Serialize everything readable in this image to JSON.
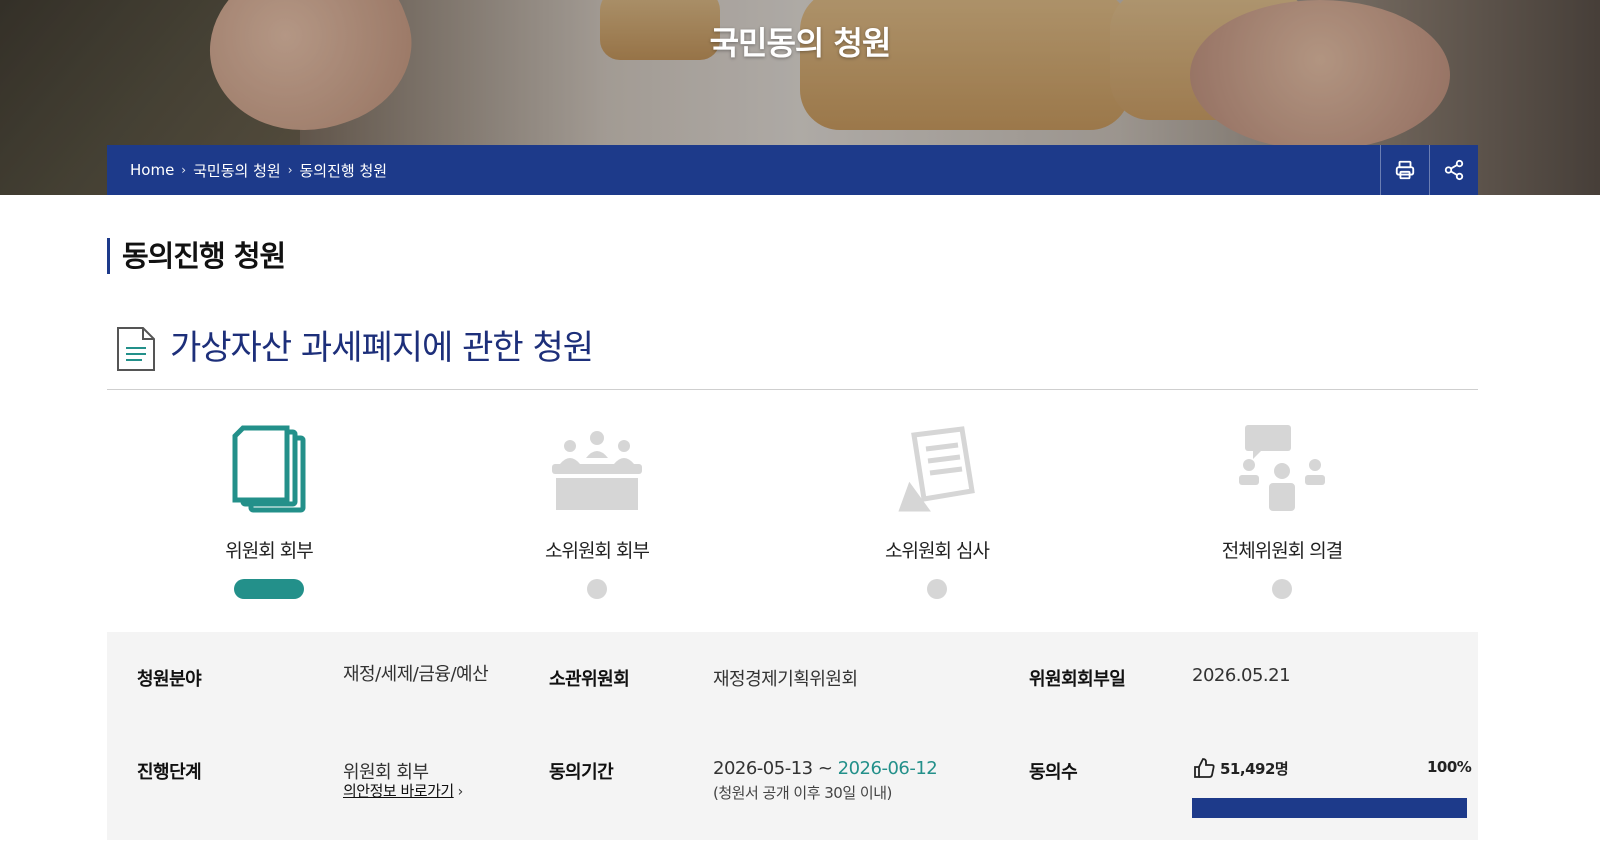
{
  "hero": {
    "title": "국민동의 청원"
  },
  "breadcrumb": {
    "home": "Home",
    "level1": "국민동의 청원",
    "level2": "동의진행 청원"
  },
  "tools": {
    "print_icon": "printer-icon",
    "share_icon": "share-icon"
  },
  "section": {
    "title": "동의진행 청원"
  },
  "petition": {
    "title": "가상자산 과세폐지에 관한 청원"
  },
  "steps": [
    {
      "label": "위원회 회부",
      "icon": "documents-icon",
      "active": true
    },
    {
      "label": "소위원회 회부",
      "icon": "meeting-icon",
      "active": false
    },
    {
      "label": "소위원회 심사",
      "icon": "review-document-icon",
      "active": false
    },
    {
      "label": "전체위원회 의결",
      "icon": "discussion-icon",
      "active": false
    }
  ],
  "info": {
    "field_label": "청원분야",
    "field_value": "재정/세제/금융/예산",
    "committee_label": "소관위원회",
    "committee_value": "재정경제기획위원회",
    "referral_label": "위원회회부일",
    "referral_value": "2026.05.21",
    "stage_label": "진행단계",
    "stage_value": "위원회 회부",
    "stage_link": "의안정보 바로가기",
    "period_label": "동의기간",
    "period_start": "2026-05-13",
    "period_sep": " ~ ",
    "period_end": "2026-06-12",
    "period_note": "(청원서 공개 이후 30일 이내)",
    "agree_label": "동의수",
    "agree_count": "51,492명",
    "agree_percent": "100%",
    "agree_progress": 1.0
  },
  "colors": {
    "navy": "#1d3a8a",
    "teal": "#23908a",
    "title_blue": "#1d2f7a"
  }
}
